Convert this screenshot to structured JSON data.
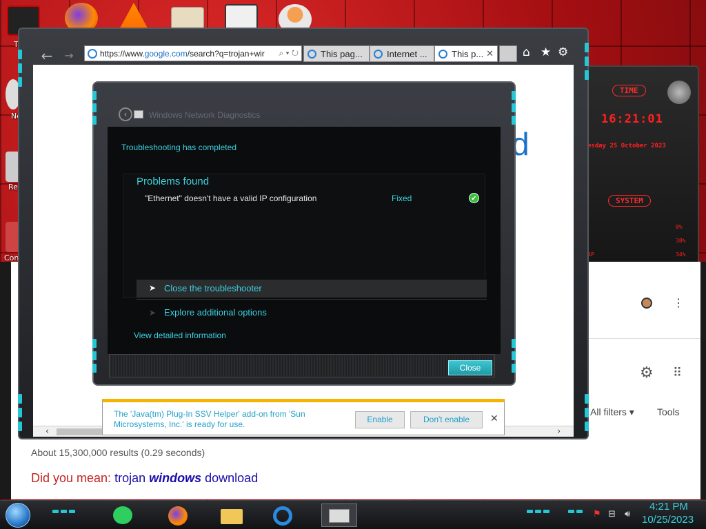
{
  "desktop": {
    "labels": [
      "T",
      "Ne",
      "Rec",
      "Cont"
    ]
  },
  "background_page": {
    "results_stats": "About 15,300,000 results (0.29 seconds)",
    "did_you_mean_label": "Did you mean:",
    "did_you_mean_q1": "trojan",
    "did_you_mean_bold": "windows",
    "did_you_mean_q2": "download",
    "all_filters": "All filters ▾",
    "tools": "Tools",
    "partial_d": "d"
  },
  "gadget": {
    "time_header": "TIME",
    "time": "16:21:01",
    "date": "esday 25 October 2023",
    "system_header": "SYSTEM",
    "stats": [
      "0%",
      "38%",
      "34%"
    ],
    "partial_label": "AP"
  },
  "browser": {
    "address_prefix": "https://www.",
    "address_domain": "google.com",
    "address_rest": "/search?q=trojan+wir",
    "address_tools": "⌕ ▾ ↻",
    "tabs": [
      {
        "label": "This pag..."
      },
      {
        "label": "Internet ..."
      },
      {
        "label": "This p..."
      }
    ],
    "tab_close": "✕",
    "icons": [
      "home-icon",
      "star-icon",
      "gear-icon"
    ]
  },
  "diagnostics": {
    "title": "Windows Network Diagnostics",
    "status": "Troubleshooting has completed",
    "problems_header": "Problems found",
    "problem_text": "\"Ethernet\" doesn't have a valid IP configuration",
    "problem_status": "Fixed",
    "option_close": "Close the troubleshooter",
    "option_explore": "Explore additional options",
    "details_link": "View detailed information",
    "close_button": "Close"
  },
  "notification": {
    "message": "The 'Java(tm) Plug-In SSV Helper' add-on from 'Sun Microsystems, Inc.' is ready for use.",
    "enable": "Enable",
    "dont_enable": "Don't enable",
    "close": "✕"
  },
  "taskbar": {
    "time": "4:21 PM",
    "date": "10/25/2023",
    "apps": [
      "notes-app-icon",
      "firefox-icon",
      "file-explorer-icon",
      "internet-explorer-icon",
      "network-diagnostics-icon"
    ]
  },
  "colors": {
    "accent_cyan": "#3dd1e0",
    "desktop_red": "#b0161a",
    "notification_bar": "#f5b400"
  }
}
